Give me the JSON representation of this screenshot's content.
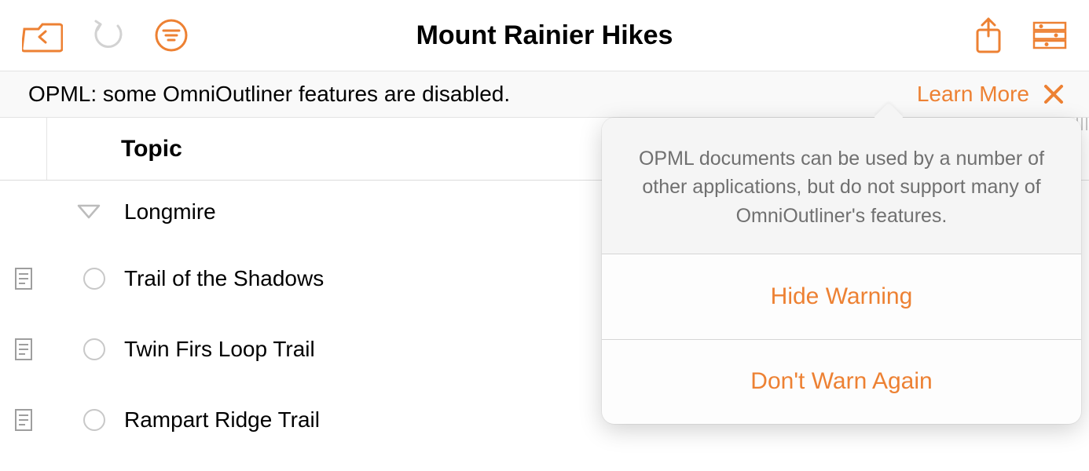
{
  "toolbar": {
    "title": "Mount Rainier Hikes",
    "icons": {
      "back": "folder-back-icon",
      "undo": "undo-icon",
      "filter": "filter-icon",
      "share": "share-icon",
      "inspector": "inspector-icon"
    }
  },
  "banner": {
    "message": "OPML: some OmniOutliner features are disabled.",
    "learn_more": "Learn More"
  },
  "columns": {
    "topic": "Topic"
  },
  "outline": {
    "root": {
      "label": "Longmire",
      "children": [
        {
          "label": "Trail of the Shadows"
        },
        {
          "label": "Twin Firs Loop Trail"
        },
        {
          "label": "Rampart Ridge Trail"
        }
      ]
    }
  },
  "popover": {
    "message": "OPML documents can be used by a number of other applications, but do not support many of OmniOutliner's features.",
    "hide": "Hide Warning",
    "dont_warn": "Don't Warn Again"
  },
  "colors": {
    "accent": "#ED8133"
  }
}
